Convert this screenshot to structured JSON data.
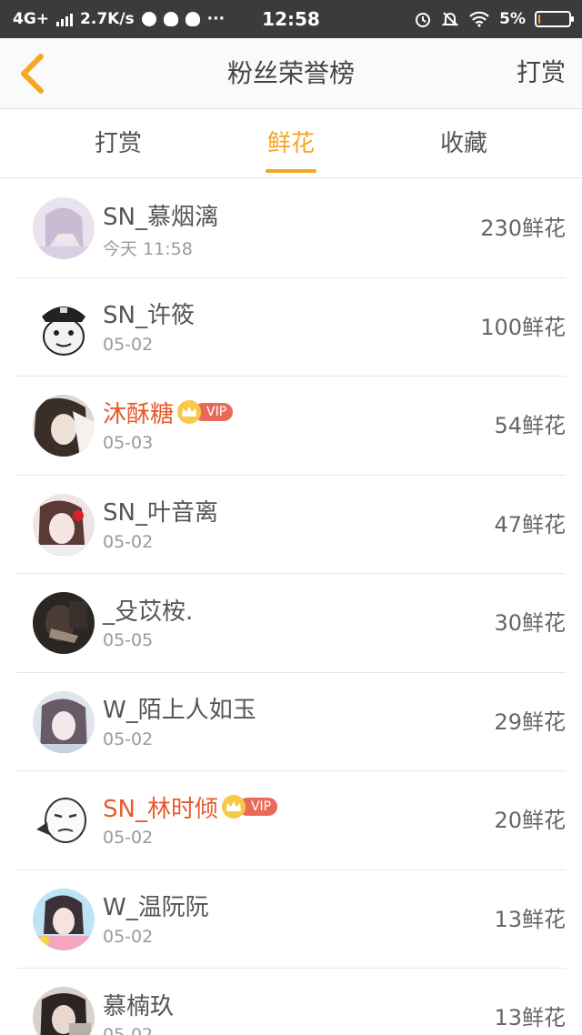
{
  "status_bar": {
    "network": "4G+",
    "speed": "2.7K/s",
    "more": "···",
    "time": "12:58",
    "battery": "5%",
    "battery_level": 0.05
  },
  "header": {
    "back_icon": "chevron-left-icon",
    "title": "粉丝荣誉榜",
    "action": "打赏"
  },
  "colors": {
    "accent": "#f5a623",
    "vip_name": "#e85a2e",
    "vip_badge": "#ea6a5a"
  },
  "tabs": [
    {
      "label": "打赏",
      "active": false
    },
    {
      "label": "鲜花",
      "active": true
    },
    {
      "label": "收藏",
      "active": false
    }
  ],
  "vip_label": "VIP",
  "fans": [
    {
      "name": "SN_慕烟漓",
      "date": "今天 11:58",
      "amount": "230鲜花",
      "vip": false
    },
    {
      "name": "SN_许筱",
      "date": "05-02",
      "amount": "100鲜花",
      "vip": false
    },
    {
      "name": "沐酥糖",
      "date": "05-03",
      "amount": "54鲜花",
      "vip": true
    },
    {
      "name": "SN_叶音离",
      "date": "05-02",
      "amount": "47鲜花",
      "vip": false
    },
    {
      "name": "_殳苡桉.",
      "date": "05-05",
      "amount": "30鲜花",
      "vip": false
    },
    {
      "name": "W_陌上人如玉",
      "date": "05-02",
      "amount": "29鲜花",
      "vip": false
    },
    {
      "name": "SN_林时倾",
      "date": "05-02",
      "amount": "20鲜花",
      "vip": true
    },
    {
      "name": "W_温阮阮",
      "date": "05-02",
      "amount": "13鲜花",
      "vip": false
    },
    {
      "name": "慕楠玖",
      "date": "05-02",
      "amount": "13鲜花",
      "vip": false
    }
  ]
}
